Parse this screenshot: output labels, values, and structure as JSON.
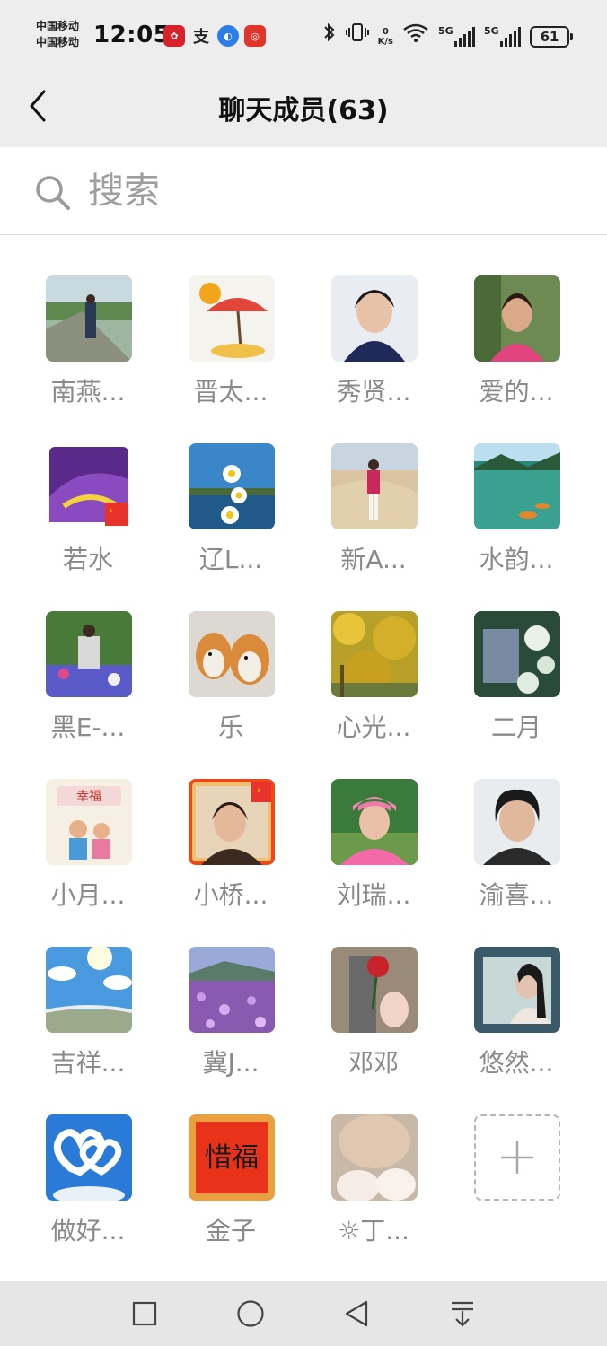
{
  "status_bar": {
    "carrier_line1": "中国移动",
    "carrier_line2": "中国移动",
    "time": "12:05",
    "net_speed_value": "0",
    "net_speed_unit": "K/s",
    "sim1_label": "5G",
    "sim2_label": "5G",
    "battery": "61",
    "app_icons": [
      "red-app-icon",
      "alipay-icon",
      "browser-icon",
      "red-coupon-app-icon"
    ],
    "status_icons": [
      "bluetooth-icon",
      "vibrate-icon",
      "wifi-icon",
      "signal-icon"
    ]
  },
  "header": {
    "title": "聊天成员(63)"
  },
  "search": {
    "placeholder": "搜索"
  },
  "members": [
    {
      "name": "南燕..."
    },
    {
      "name": "晋太..."
    },
    {
      "name": "秀贤..."
    },
    {
      "name": "爱的..."
    },
    {
      "name": "若水"
    },
    {
      "name": "辽L..."
    },
    {
      "name": "新A..."
    },
    {
      "name": "水韵..."
    },
    {
      "name": "黑E-..."
    },
    {
      "name": "乐"
    },
    {
      "name": "心光..."
    },
    {
      "name": "二月"
    },
    {
      "name": "小月..."
    },
    {
      "name": "小桥..."
    },
    {
      "name": "刘瑞..."
    },
    {
      "name": "渝喜..."
    },
    {
      "name": "吉祥..."
    },
    {
      "name": "冀J..."
    },
    {
      "name": "邓邓"
    },
    {
      "name": "悠然..."
    },
    {
      "name": "做好..."
    },
    {
      "name": "金子"
    },
    {
      "name": "☼丁..."
    }
  ],
  "add_member": {
    "icon": "plus-icon"
  },
  "avatar_art": {
    "avatar_text_1": "幸福",
    "avatar_text_2": "惜福"
  },
  "navbar": {
    "icons": [
      "square-icon",
      "circle-icon",
      "back-triangle-icon",
      "notification-pull-icon"
    ]
  }
}
